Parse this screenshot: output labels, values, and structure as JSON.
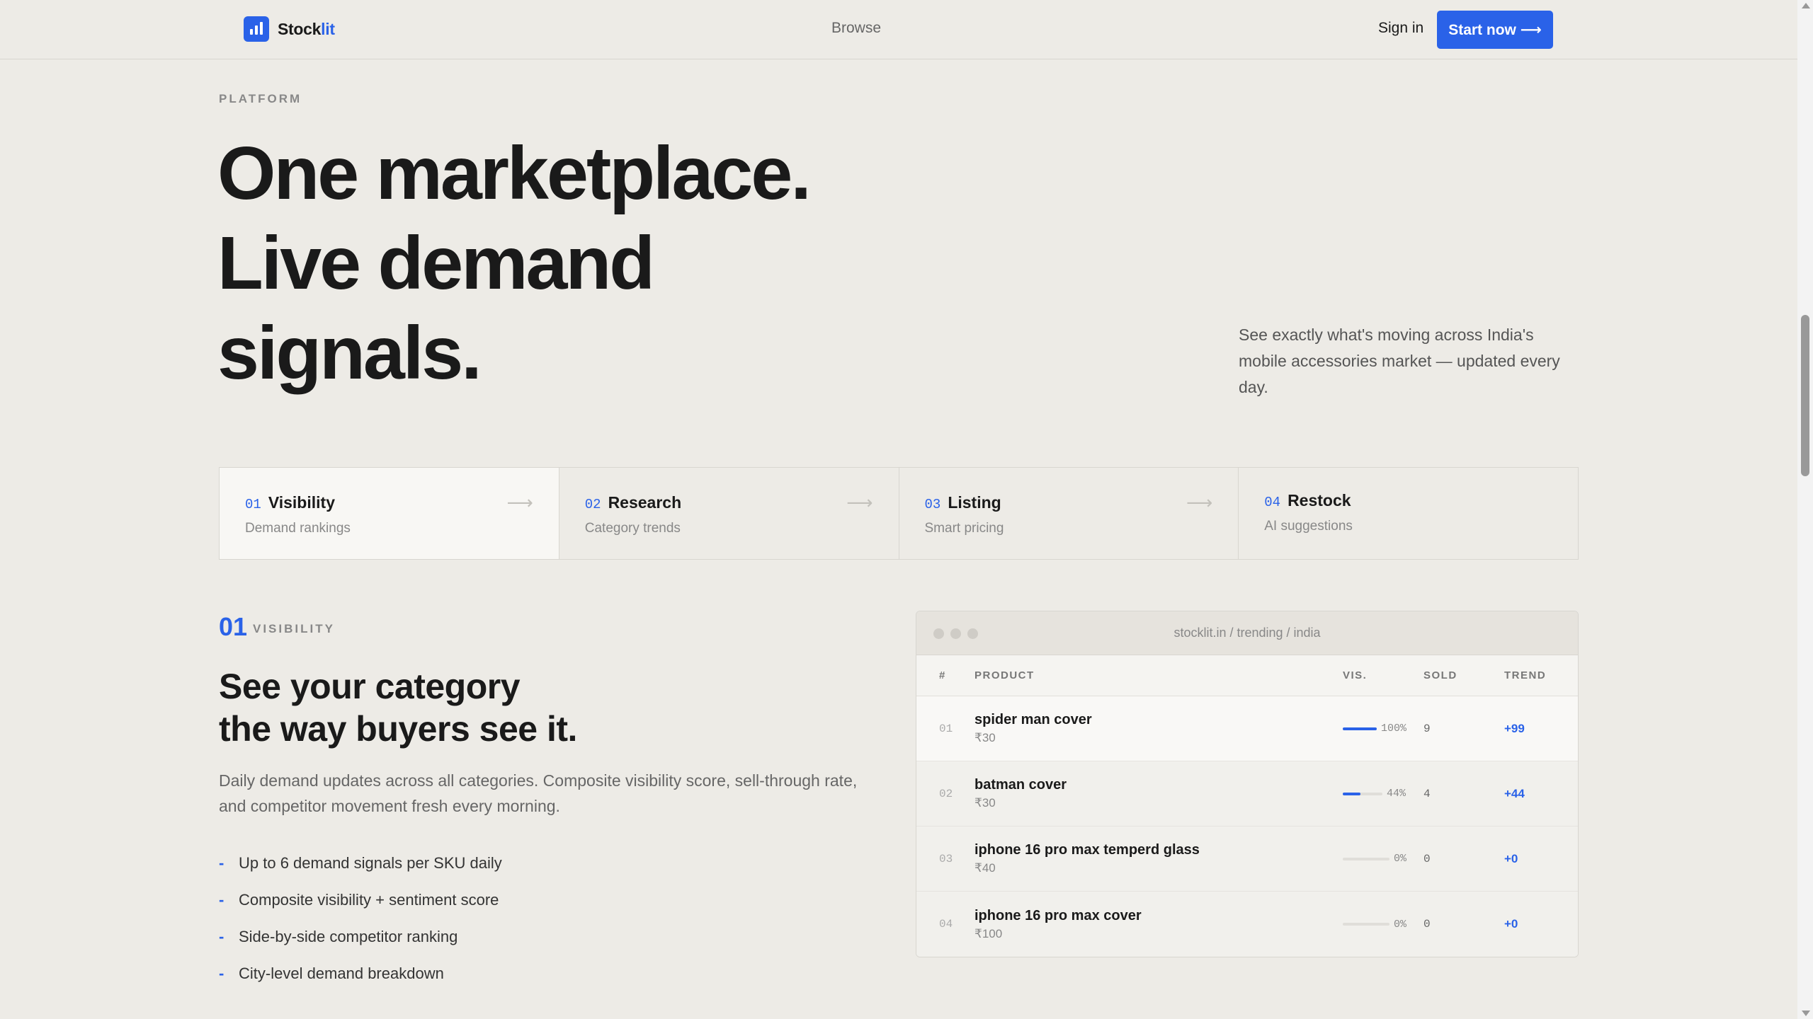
{
  "header": {
    "logo_text_a": "Stock",
    "logo_text_b": "lit",
    "browse_label": "Browse",
    "signin_label": "Sign in",
    "start_label": "Start now ⟶"
  },
  "hero": {
    "eyebrow": "PLATFORM",
    "title_line1": "One marketplace.",
    "title_line2": "Live demand",
    "title_line3": "signals.",
    "subtitle": "See exactly what's moving across India's mobile accessories market — updated every day."
  },
  "steps": [
    {
      "num": "01",
      "title": "Visibility",
      "desc": "Demand rankings",
      "arrow": "⟶"
    },
    {
      "num": "02",
      "title": "Research",
      "desc": "Category trends",
      "arrow": "⟶"
    },
    {
      "num": "03",
      "title": "Listing",
      "desc": "Smart pricing",
      "arrow": "⟶"
    },
    {
      "num": "04",
      "title": "Restock",
      "desc": "AI suggestions"
    }
  ],
  "section": {
    "num": "01",
    "label": "VISIBILITY",
    "title_line1": "See your category",
    "title_line2": "the way buyers see it.",
    "desc": "Daily demand updates across all categories. Composite visibility score, sell-through rate, and competitor movement fresh every morning.",
    "bullet_mark": "-",
    "bullets": [
      "Up to 6 demand signals per SKU daily",
      "Composite visibility + sentiment score",
      "Side-by-side competitor ranking",
      "City-level demand breakdown"
    ]
  },
  "browser": {
    "url": "stocklit.in / trending / india",
    "columns": {
      "idx": "#",
      "product": "PRODUCT",
      "vis": "VIS.",
      "sold": "SOLD",
      "trend": "TREND"
    },
    "rows": [
      {
        "idx": "01",
        "name": "spider man cover",
        "price": "₹30",
        "vis_pct": "100%",
        "vis_value": 1.0,
        "sold": "9",
        "trend": "+99"
      },
      {
        "idx": "02",
        "name": "batman cover",
        "price": "₹30",
        "vis_pct": "44%",
        "vis_value": 0.44,
        "sold": "4",
        "trend": "+44"
      },
      {
        "idx": "03",
        "name": "iphone 16 pro max temperd glass",
        "price": "₹40",
        "vis_pct": "0%",
        "vis_value": 0,
        "sold": "0",
        "trend": "+0"
      },
      {
        "idx": "04",
        "name": "iphone 16 pro max cover",
        "price": "₹100",
        "vis_pct": "0%",
        "vis_value": 0,
        "sold": "0",
        "trend": "+0"
      }
    ]
  },
  "colors": {
    "accent": "#2a62e8",
    "background": "#edebe6",
    "text": "#1a1a1a"
  }
}
